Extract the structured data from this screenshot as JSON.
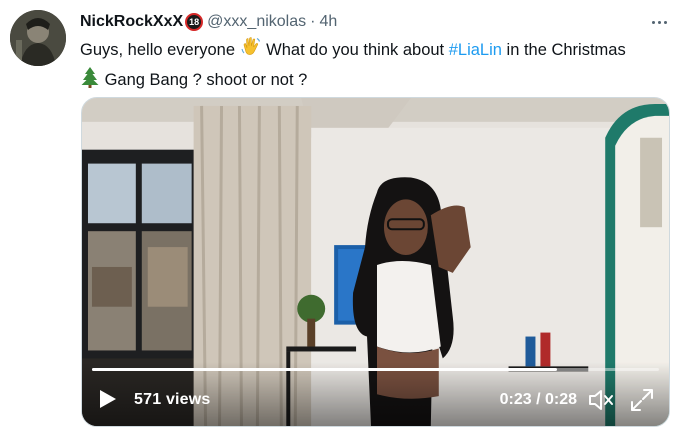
{
  "tweet": {
    "display_name": "NickRockXxX",
    "badge_label": "18",
    "handle": "@xxx_nikolas",
    "separator": "·",
    "time": "4h",
    "text_part1": "Guys, hello everyone ",
    "text_part2": " What do you think about ",
    "hashtag": "#LiaLin",
    "text_part3": " in the Christmas",
    "text_part4": " Gang Bang ? shoot or not ?",
    "emoji_1": "waving-hand-emoji",
    "emoji_2": "christmas-tree-emoji"
  },
  "video": {
    "views_label": "571 views",
    "timecode": "0:23 / 0:28",
    "progress_fraction": 0.82,
    "accent_color": "#ffffff"
  },
  "colors": {
    "hashtag": "#1d9bf0",
    "text": "#0f1419",
    "secondary": "#536471"
  }
}
